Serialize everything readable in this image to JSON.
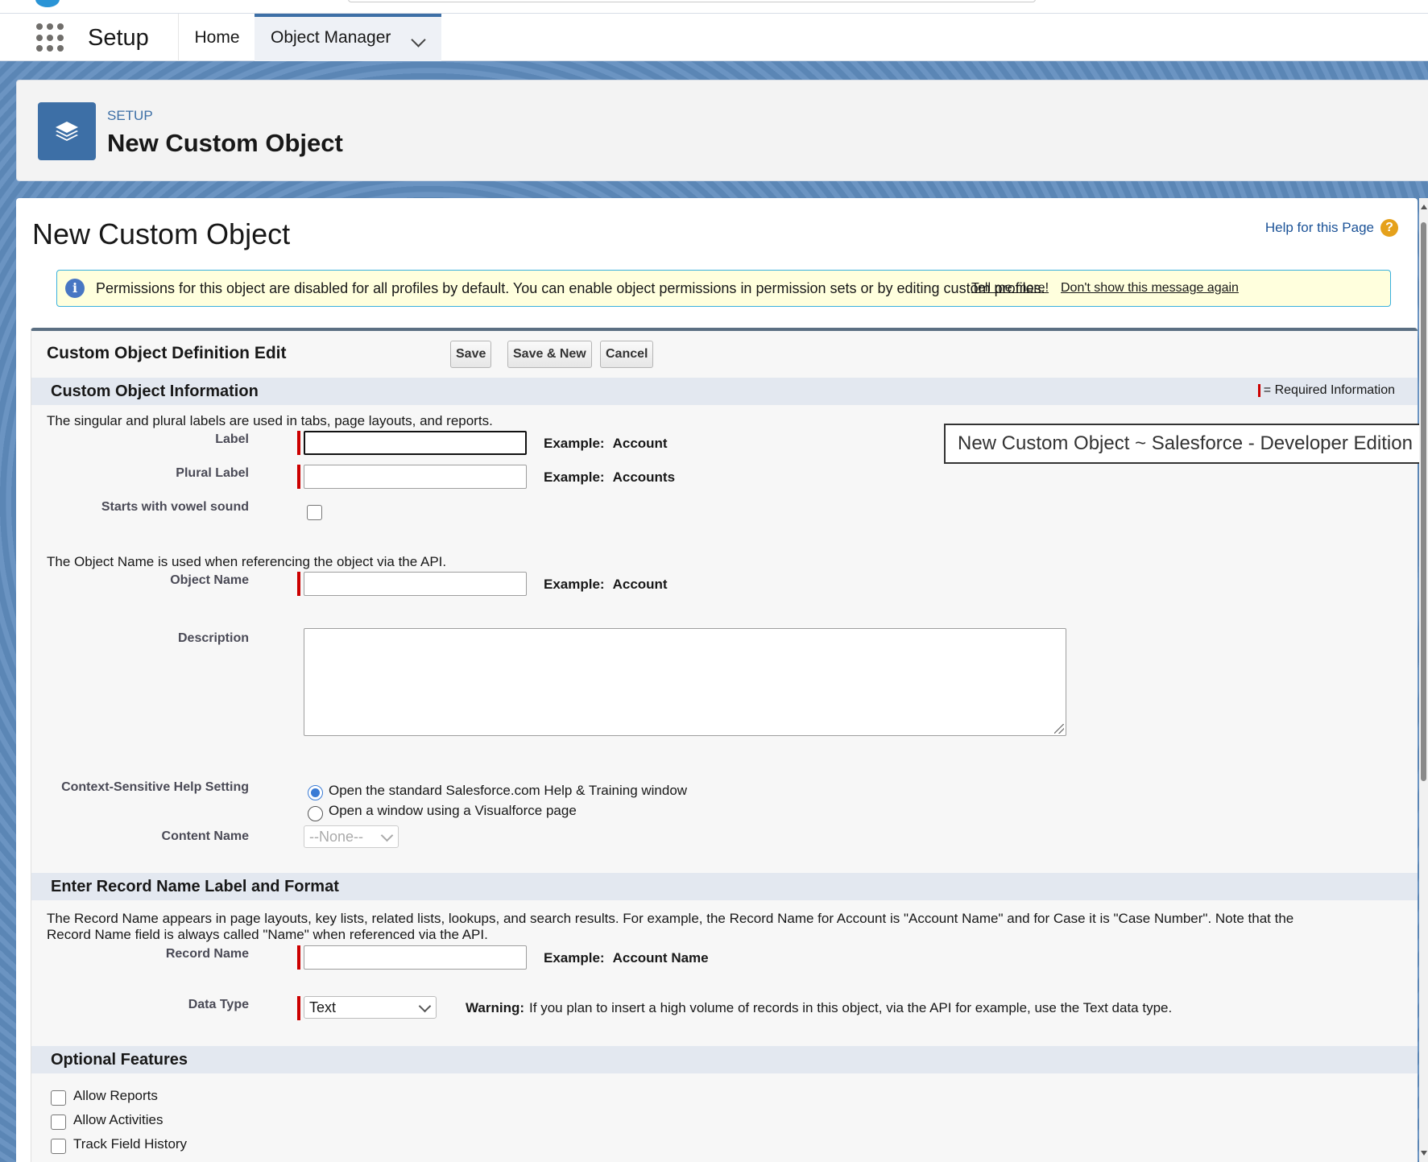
{
  "nav": {
    "app_name": "Setup",
    "tabs": [
      {
        "label": "Home"
      },
      {
        "label": "Object Manager"
      }
    ]
  },
  "page_header": {
    "eyebrow": "SETUP",
    "title": "New Custom Object"
  },
  "main": {
    "heading": "New Custom Object",
    "help_link": "Help for this Page",
    "message": {
      "text": "Permissions for this object are disabled for all profiles by default. You can enable object permissions in permission sets or by editing custom profiles.",
      "link1": "Tell me more!",
      "link2": "Don't show this message again"
    }
  },
  "form": {
    "title": "Custom Object Definition Edit",
    "buttons": {
      "save": "Save",
      "save_new": "Save & New",
      "cancel": "Cancel"
    },
    "required_info": "= Required Information",
    "section1": {
      "title": "Custom Object Information",
      "intro": "The singular and plural labels are used in tabs, page layouts, and reports.",
      "label": {
        "label": "Label",
        "value": "",
        "example_label": "Example:",
        "example": "Account"
      },
      "plural_label": {
        "label": "Plural Label",
        "value": "",
        "example_label": "Example:",
        "example": "Accounts"
      },
      "vowel": {
        "label": "Starts with vowel sound",
        "checked": false
      },
      "object_intro": "The Object Name is used when referencing the object via the API.",
      "object_name": {
        "label": "Object Name",
        "value": "",
        "example_label": "Example:",
        "example": "Account"
      },
      "description": {
        "label": "Description",
        "value": ""
      },
      "help_setting": {
        "label": "Context-Sensitive Help Setting",
        "options": [
          "Open the standard Salesforce.com Help & Training window",
          "Open a window using a Visualforce page"
        ],
        "selected": 0
      },
      "content_name": {
        "label": "Content Name",
        "value": "--None--"
      }
    },
    "section2": {
      "title": "Enter Record Name Label and Format",
      "intro_line1": "The Record Name appears in page layouts, key lists, related lists, lookups, and search results. For example, the Record Name for Account is \"Account Name\" and for Case it is \"Case Number\". Note that the",
      "intro_line2": "Record Name field is always called \"Name\" when referenced via the API.",
      "record_name": {
        "label": "Record Name",
        "value": "",
        "example_label": "Example:",
        "example": "Account Name"
      },
      "data_type": {
        "label": "Data Type",
        "value": "Text",
        "warning_label": "Warning:",
        "warning": "If you plan to insert a high volume of records in this object, via the API for example, use the Text data type."
      }
    },
    "section3": {
      "title": "Optional Features",
      "options": [
        {
          "label": "Allow Reports",
          "checked": false
        },
        {
          "label": "Allow Activities",
          "checked": false
        },
        {
          "label": "Track Field History",
          "checked": false
        }
      ]
    }
  },
  "tooltip": "New Custom Object ~ Salesforce - Developer Edition",
  "colors": {
    "brand_blue": "#3d6fa6",
    "required_red": "#cc0000",
    "info_bg": "#ffffdd",
    "section_bg": "#e3e8f0"
  }
}
